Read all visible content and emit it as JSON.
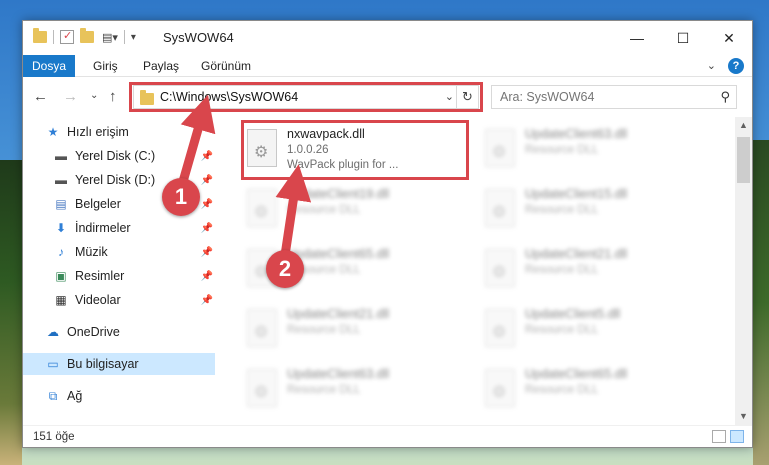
{
  "window": {
    "title": "SysWOW64",
    "minimize_glyph": "—",
    "maximize_glyph": "☐",
    "close_glyph": "✕"
  },
  "ribbon": {
    "tabs": [
      "Dosya",
      "Giriş",
      "Paylaş",
      "Görünüm"
    ],
    "help_glyph": "?"
  },
  "navigation": {
    "address_path": "C:\\Windows\\SysWOW64",
    "search_placeholder": "Ara: SysWOW64"
  },
  "sidebar": {
    "items": [
      {
        "label": "Hızlı erişim",
        "icon": "star-icon"
      },
      {
        "label": "Yerel Disk (C:)",
        "icon": "drive-icon"
      },
      {
        "label": "Yerel Disk (D:)",
        "icon": "drive-icon"
      },
      {
        "label": "Belgeler",
        "icon": "documents-icon"
      },
      {
        "label": "İndirmeler",
        "icon": "download-icon"
      },
      {
        "label": "Müzik",
        "icon": "music-icon"
      },
      {
        "label": "Resimler",
        "icon": "pictures-icon"
      },
      {
        "label": "Videolar",
        "icon": "videos-icon"
      },
      {
        "label": "OneDrive",
        "icon": "cloud-icon"
      },
      {
        "label": "Bu bilgisayar",
        "icon": "computer-icon"
      },
      {
        "label": "Ağ",
        "icon": "network-icon"
      }
    ]
  },
  "files": {
    "highlighted": {
      "name": "nxwavpack.dll",
      "version": "1.0.0.26",
      "description": "WavPack plugin for ..."
    },
    "others": [
      {
        "name": "UpdateClient63.dll",
        "type": "Resource DLL"
      },
      {
        "name": "UpdateClient19.dll",
        "type": "Resource DLL"
      },
      {
        "name": "UpdateClient15.dll",
        "type": "Resource DLL"
      },
      {
        "name": "UpdateClient65.dll",
        "type": "Resource DLL"
      },
      {
        "name": "UpdateClient21.dll",
        "type": "Resource DLL"
      },
      {
        "name": "UpdateClient21.dll",
        "type": "Resource DLL"
      },
      {
        "name": "UpdateClient5.dll",
        "type": "Resource DLL"
      },
      {
        "name": "UpdateClient63.dll",
        "type": "Resource DLL"
      },
      {
        "name": "UpdateClient65.dll",
        "type": "Resource DLL"
      }
    ]
  },
  "status": {
    "item_count": "151 öğe"
  },
  "annotations": {
    "marker_1": "1",
    "marker_2": "2",
    "color": "#d9464c"
  }
}
